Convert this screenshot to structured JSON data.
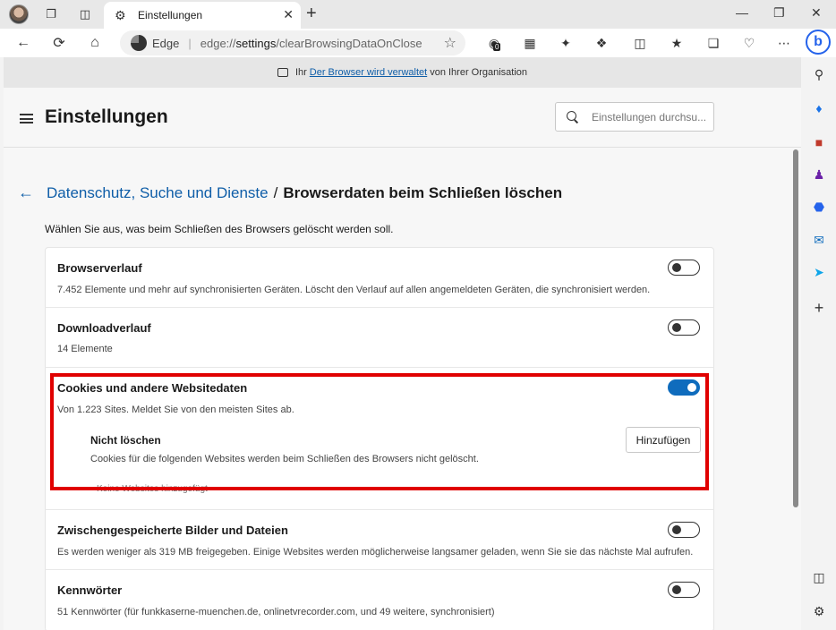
{
  "browser": {
    "tab": {
      "title": "Einstellungen"
    },
    "address": {
      "site_label": "Edge",
      "url_prefix": "edge://",
      "url_host": "settings",
      "url_path": "/clearBrowsingDataOnClose"
    },
    "extension_badge": "0"
  },
  "managed_bar": {
    "prefix": "Ihr",
    "link": "Der Browser wird verwaltet",
    "suffix": "von Ihrer Organisation"
  },
  "settings": {
    "title": "Einstellungen",
    "search_placeholder": "Einstellungen durchsu..."
  },
  "breadcrumb": {
    "parent": "Datenschutz, Suche und Dienste",
    "separator": "/",
    "current": "Browserdaten beim Schließen löschen"
  },
  "intro": "Wählen Sie aus, was beim Schließen des Browsers gelöscht werden soll.",
  "items": [
    {
      "title": "Browserverlauf",
      "desc": "7.452 Elemente und mehr auf synchronisierten Geräten. Löscht den Verlauf auf allen angemeldeten Geräten, die synchronisiert werden.",
      "on": false
    },
    {
      "title": "Downloadverlauf",
      "desc": "14 Elemente",
      "on": false
    },
    {
      "title": "Cookies und andere Websitedaten",
      "desc": "Von 1.223 Sites. Meldet Sie von den meisten Sites ab.",
      "on": true
    },
    {
      "title": "Zwischengespeicherte Bilder und Dateien",
      "desc": "Es werden weniger als 319 MB freigegeben. Einige Websites werden möglicherweise langsamer geladen, wenn Sie sie das nächste Mal aufrufen.",
      "on": false
    },
    {
      "title": "Kennwörter",
      "desc": "51 Kennwörter (für funkkaserne-muenchen.de, onlinetvrecorder.com, und 49 weitere, synchronisiert)",
      "on": false
    }
  ],
  "cookies_exceptions": {
    "title": "Nicht löschen",
    "desc": "Cookies für die folgenden Websites werden beim Schließen des Browsers nicht gelöscht.",
    "add_button": "Hinzufügen",
    "empty_note": "Keine Websites hinzugefügt"
  },
  "colors": {
    "accent": "#0f6cbd",
    "highlight": "#e00000",
    "link": "#0f5ea8"
  }
}
